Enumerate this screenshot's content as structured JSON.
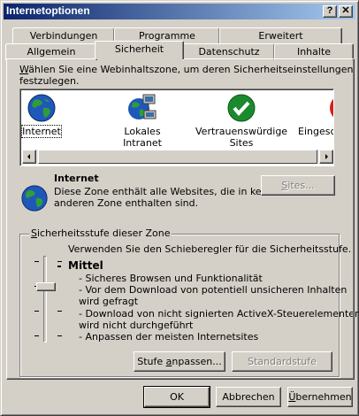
{
  "window": {
    "title": "Internetoptionen",
    "help_label": "?",
    "close_label": "✕"
  },
  "tabs": {
    "verbindungen": "Verbindungen",
    "programme": "Programme",
    "erweitert": "Erweitert",
    "allgemein": "Allgemein",
    "sicherheit": "Sicherheit",
    "datenschutz": "Datenschutz",
    "inhalte": "Inhalte"
  },
  "instruction": {
    "line1_prefix": "W",
    "line1_rest": "ählen Sie eine Webinhaltszone, um deren Sicherheitseinstellungen",
    "line2": "festzulegen."
  },
  "zones": [
    {
      "label": "Internet",
      "icon": "globe-icon"
    },
    {
      "label": "Lokales Intranet",
      "icon": "intranet-icon"
    },
    {
      "label": "Vertrauenswürdige",
      "label2": "Sites",
      "icon": "checkmark-icon"
    },
    {
      "label": "Eingesc",
      "icon": "restricted-icon"
    }
  ],
  "selected_zone": {
    "title": "Internet",
    "desc1": "Diese Zone enthält alle Websites, die in keiner",
    "desc2": "anderen Zone enthalten sind."
  },
  "sites_button": {
    "prefix": "S",
    "rest": "ites..."
  },
  "security": {
    "group_prefix": "S",
    "group_rest": "icherheitsstufe dieser Zone",
    "slider_hint": "Verwenden Sie den Schieberegler für die Sicherheitsstufe.",
    "level_name": "Mittel",
    "bullets": [
      "- Sicheres Browsen und Funktionalität",
      "- Vor dem Download von potentiell unsicheren Inhalten",
      "wird gefragt",
      "- Download von nicht signierten ActiveX-Steuerelementen",
      "wird nicht durchgeführt",
      "- Anpassen der meisten Internetsites"
    ],
    "custom_button": {
      "before": "Stufe ",
      "underlined": "a",
      "after": "npassen..."
    },
    "default_button": "Standardstufe"
  },
  "footer": {
    "ok": "OK",
    "cancel": "Abbrechen",
    "apply_prefix": "Ü",
    "apply_rest": "bernehmen"
  },
  "colors": {
    "title_start": "#0a246a",
    "title_end": "#a6caf0",
    "face": "#d4d0c8"
  }
}
